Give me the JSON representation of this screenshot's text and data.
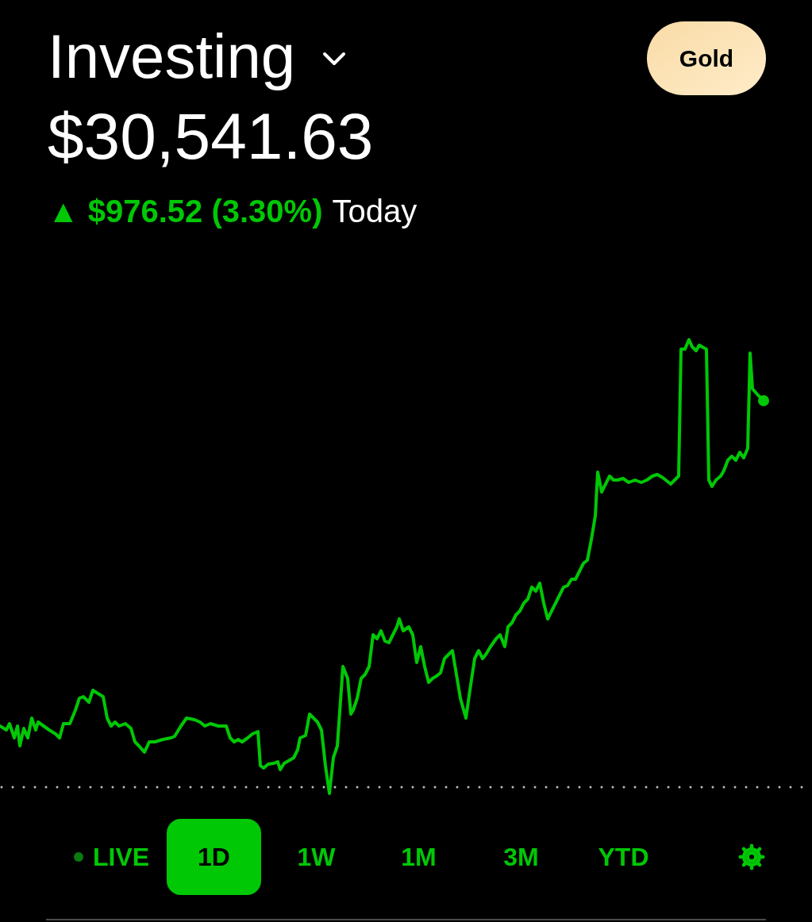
{
  "header": {
    "title": "Investing",
    "badge": "Gold"
  },
  "portfolio": {
    "value": "$30,541.63",
    "change": {
      "arrow": "▲",
      "amount": "$976.52 (3.30%)",
      "period": "Today"
    }
  },
  "ranges": [
    {
      "label": "LIVE",
      "kind": "live",
      "selected": false
    },
    {
      "label": "1D",
      "kind": "range",
      "selected": true
    },
    {
      "label": "1W",
      "kind": "range",
      "selected": false
    },
    {
      "label": "1M",
      "kind": "range",
      "selected": false
    },
    {
      "label": "3M",
      "kind": "range",
      "selected": false
    },
    {
      "label": "YTD",
      "kind": "range",
      "selected": false
    }
  ]
}
